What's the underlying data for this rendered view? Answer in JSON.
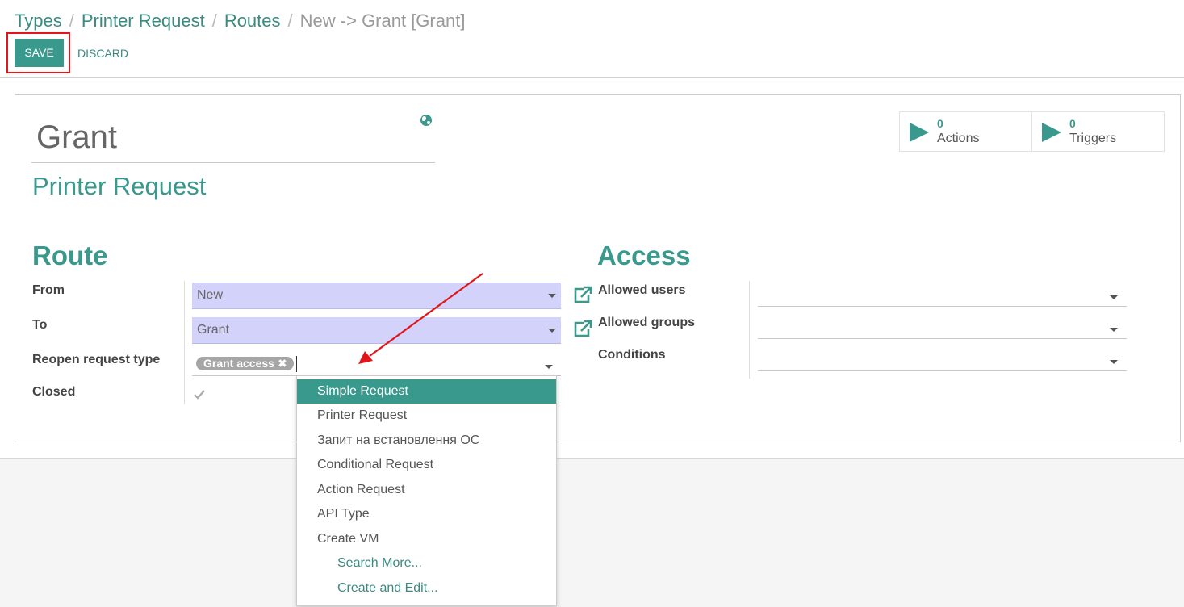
{
  "breadcrumb": {
    "items": [
      "Types",
      "Printer Request",
      "Routes"
    ],
    "current": "New -> Grant [Grant]"
  },
  "toolbar": {
    "save_label": "SAVE",
    "discard_label": "DISCARD"
  },
  "stats": {
    "actions": {
      "count": "0",
      "label": "Actions"
    },
    "triggers": {
      "count": "0",
      "label": "Triggers"
    }
  },
  "record": {
    "name": "Grant",
    "request_type": "Printer Request"
  },
  "route": {
    "title": "Route",
    "from_label": "From",
    "from_value": "New",
    "to_label": "To",
    "to_value": "Grant",
    "reopen_label": "Reopen request type",
    "reopen_tag": "Grant access",
    "closed_label": "Closed",
    "closed_checked": true
  },
  "access": {
    "title": "Access",
    "allowed_users_label": "Allowed users",
    "allowed_groups_label": "Allowed groups",
    "conditions_label": "Conditions"
  },
  "dropdown": {
    "items": [
      "Simple Request",
      "Printer Request",
      "Запит на встановлення ОС",
      "Conditional Request",
      "Action Request",
      "API Type",
      "Create VM"
    ],
    "search_more": "Search More...",
    "create_edit": "Create and Edit..."
  },
  "colors": {
    "accent": "#38998c",
    "highlight": "#e0161b",
    "filled_field": "#d2d2fb"
  }
}
